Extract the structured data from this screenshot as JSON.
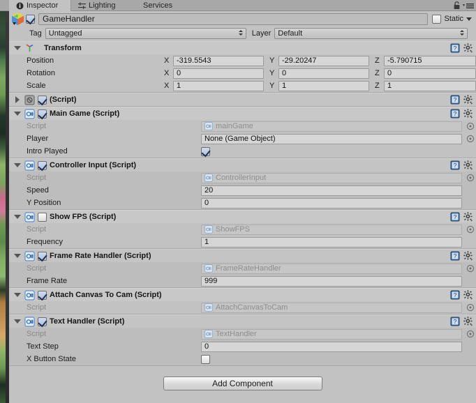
{
  "window": {
    "tabs": [
      {
        "label": "Inspector",
        "icon": "info-icon",
        "active": true
      },
      {
        "label": "Lighting",
        "icon": "lighting-icon",
        "active": false
      },
      {
        "label": "Services",
        "icon": "",
        "active": false
      }
    ],
    "lock_icon": "lock-icon",
    "menu_icon": "hamburger-menu-icon"
  },
  "object_header": {
    "icon": "gameobject-cube-icon",
    "enabled": true,
    "name": "GameHandler",
    "static_label": "Static",
    "static_checked": false
  },
  "tag_layer": {
    "tag_label": "Tag",
    "tag_value": "Untagged",
    "layer_label": "Layer",
    "layer_value": "Default"
  },
  "components": [
    {
      "name": "Transform",
      "title": "Transform",
      "icon": "transform-axis-icon",
      "expanded": true,
      "has_enable_toggle": false,
      "rows": [
        {
          "type": "vector3",
          "label": "Position",
          "x": "-319.5543",
          "y": "-29.20247",
          "z": "-5.790715"
        },
        {
          "type": "vector3",
          "label": "Rotation",
          "x": "0",
          "y": "0",
          "z": "0"
        },
        {
          "type": "vector3",
          "label": "Scale",
          "x": "1",
          "y": "1",
          "z": "1"
        }
      ]
    },
    {
      "name": "missing-script",
      "title": "(Script)",
      "icon": "missing-script-icon",
      "expanded": false,
      "has_enable_toggle": true,
      "enabled": true,
      "rows": []
    },
    {
      "name": "main-game",
      "title": "Main Game (Script)",
      "icon": "csharp-script-icon",
      "expanded": true,
      "has_enable_toggle": true,
      "enabled": true,
      "rows": [
        {
          "type": "script",
          "label": "Script",
          "value": "mainGame"
        },
        {
          "type": "object",
          "label": "Player",
          "value": "None (Game Object)"
        },
        {
          "type": "checkbox",
          "label": "Intro Played",
          "checked": true
        }
      ]
    },
    {
      "name": "controller-input",
      "title": "Controller Input (Script)",
      "icon": "csharp-script-icon",
      "expanded": true,
      "has_enable_toggle": true,
      "enabled": true,
      "rows": [
        {
          "type": "script",
          "label": "Script",
          "value": "ControllerInput"
        },
        {
          "type": "text",
          "label": "Speed",
          "value": "20"
        },
        {
          "type": "text",
          "label": "Y Position",
          "value": "0"
        }
      ]
    },
    {
      "name": "show-fps",
      "title": "Show FPS (Script)",
      "icon": "csharp-script-icon",
      "expanded": true,
      "has_enable_toggle": true,
      "enabled": false,
      "rows": [
        {
          "type": "script",
          "label": "Script",
          "value": "ShowFPS"
        },
        {
          "type": "text",
          "label": "Frequency",
          "value": "1"
        }
      ]
    },
    {
      "name": "frame-rate-handler",
      "title": "Frame Rate Handler (Script)",
      "icon": "csharp-script-icon",
      "expanded": true,
      "has_enable_toggle": true,
      "enabled": true,
      "rows": [
        {
          "type": "script",
          "label": "Script",
          "value": "FrameRateHandler"
        },
        {
          "type": "text",
          "label": "Frame Rate",
          "value": "999"
        }
      ]
    },
    {
      "name": "attach-canvas-to-cam",
      "title": "Attach Canvas To Cam (Script)",
      "icon": "csharp-script-icon",
      "expanded": true,
      "has_enable_toggle": true,
      "enabled": true,
      "rows": [
        {
          "type": "script",
          "label": "Script",
          "value": "AttachCanvasToCam"
        }
      ]
    },
    {
      "name": "text-handler",
      "title": "Text Handler (Script)",
      "icon": "csharp-script-icon",
      "expanded": true,
      "has_enable_toggle": true,
      "enabled": true,
      "rows": [
        {
          "type": "script",
          "label": "Script",
          "value": "TextHandler"
        },
        {
          "type": "text",
          "label": "Text Step",
          "value": "0"
        },
        {
          "type": "checkbox",
          "label": "X Button State",
          "checked": false
        }
      ]
    }
  ],
  "footer": {
    "add_component_label": "Add Component"
  },
  "colors": {
    "panel_bg": "#c2c2c2",
    "tabbar_bg": "#a8a8a8",
    "header_bg": "#c8c8c8",
    "field_bg": "#d6d6d6",
    "field_readonly_bg": "#c6c6c6",
    "accent_blue": "#5a8fd0"
  }
}
